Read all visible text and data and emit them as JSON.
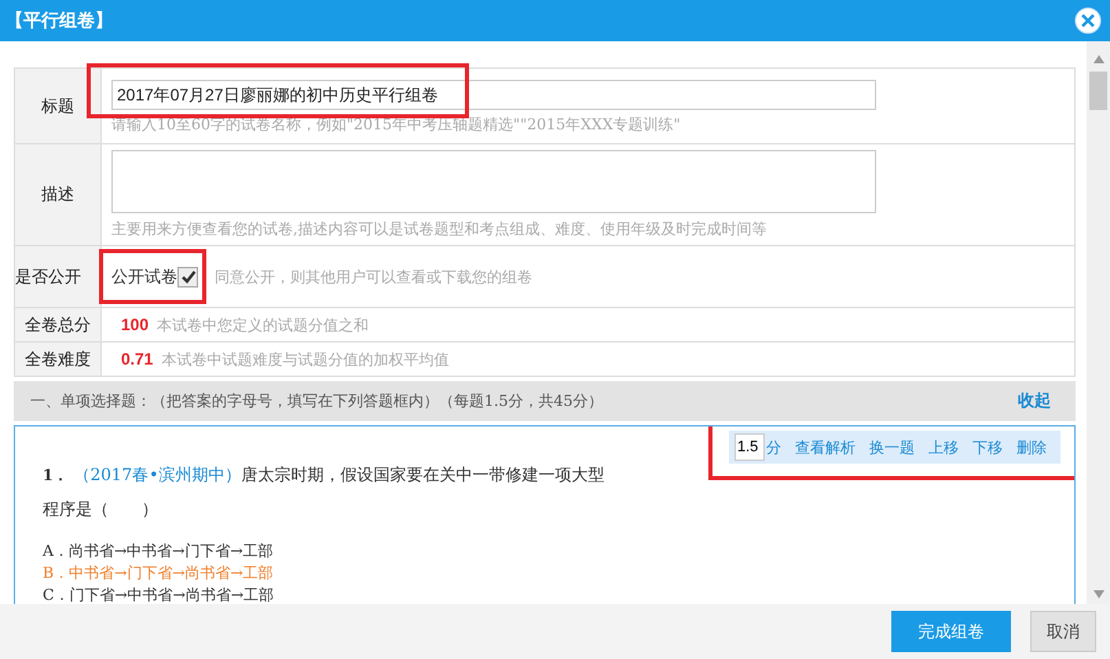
{
  "window": {
    "title": "【平行组卷】"
  },
  "form": {
    "title": {
      "label": "标题",
      "value": "2017年07月27日廖丽娜的初中历史平行组卷",
      "hint": "请输入10至60字的试卷名称，例如\"2015年中考压轴题精选\"\"2015年XXX专题训练\"",
      "highlighted": true
    },
    "description": {
      "label": "描述",
      "hint": "主要用来方便查看您的试卷,描述内容可以是试卷题型和考点组成、难度、使用年级及时完成时间等"
    },
    "publish": {
      "label": "是否公开",
      "option": "公开试卷",
      "checked": true,
      "hint": "同意公开，则其他用户可以查看或下载您的组卷",
      "highlighted": true
    },
    "total": {
      "label": "全卷总分",
      "value": "100",
      "hint": "本试卷中您定义的试题分值之和"
    },
    "difficulty": {
      "label": "全卷难度",
      "value": "0.71",
      "hint": "本试卷中试题难度与试题分值的加权平均值"
    }
  },
  "section": {
    "heading": "一、单项选择题：（把答案的字母号，填写在下列答题框内）（每题1.5分，共45分）",
    "collapse": "收起"
  },
  "question": {
    "number": "1．",
    "source": "（2017春•滨州期中）",
    "text": "唐太宗时期，假设国家要在关中一带修建一项大型",
    "text_line2": "程序是（　　）",
    "toolbar": {
      "score": "1.5",
      "unit": "分",
      "actions": [
        "查看解析",
        "换一题",
        "上移",
        "下移",
        "删除"
      ],
      "highlighted": true
    },
    "options": [
      {
        "letter": "A．",
        "text": "尚书省→中书省→门下省→工部",
        "selected": false
      },
      {
        "letter": "B．",
        "text": "中书省→门下省→尚书省→工部",
        "selected": true
      },
      {
        "letter": "C．",
        "text": "门下省→中书省→尚书省→工部",
        "selected": false
      }
    ]
  },
  "buttons": [
    {
      "label": "完成组卷",
      "kind": "primary"
    },
    {
      "label": "取消",
      "kind": "secondary"
    }
  ]
}
